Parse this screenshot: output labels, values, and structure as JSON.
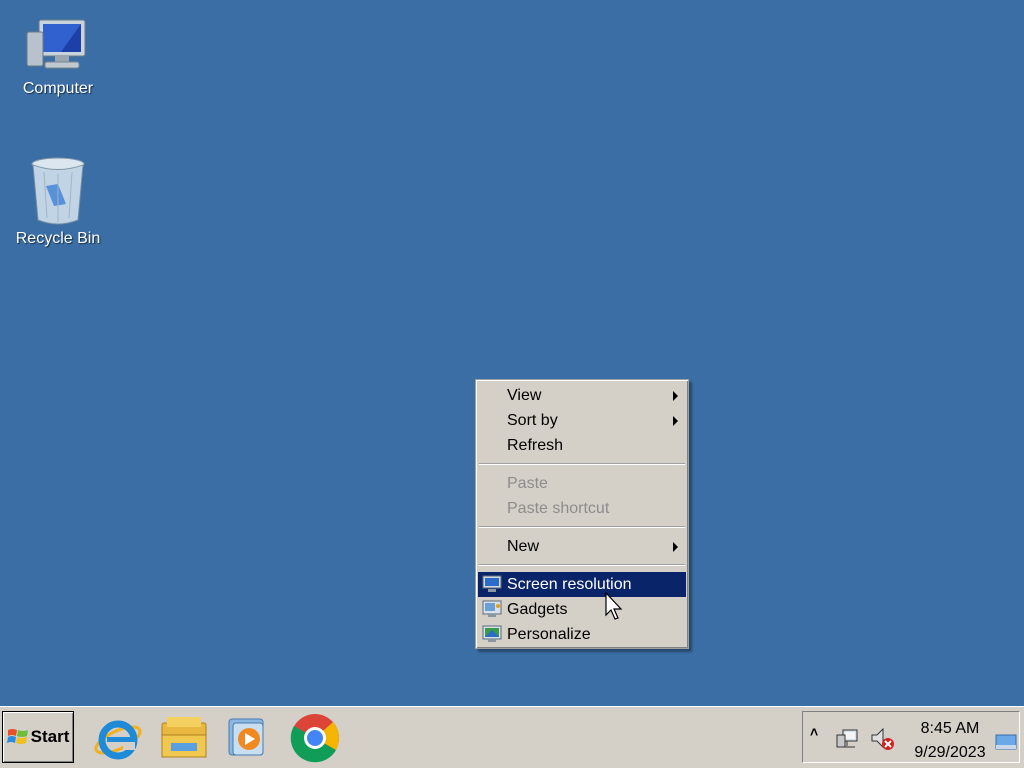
{
  "desktop": {
    "icons": [
      {
        "label": "Computer",
        "icon": "computer-icon"
      },
      {
        "label": "Recycle Bin",
        "icon": "recycle-bin-icon"
      }
    ],
    "background_color": "#3a6ea5"
  },
  "context_menu": {
    "items": [
      {
        "label": "View",
        "has_submenu": true
      },
      {
        "label": "Sort by",
        "has_submenu": true
      },
      {
        "label": "Refresh"
      },
      {
        "label": "Paste",
        "disabled": true
      },
      {
        "label": "Paste shortcut",
        "disabled": true
      },
      {
        "label": "New",
        "has_submenu": true
      },
      {
        "label": "Screen resolution",
        "icon": "display-icon",
        "highlighted": true
      },
      {
        "label": "Gadgets",
        "icon": "gadgets-icon"
      },
      {
        "label": "Personalize",
        "icon": "personalize-icon"
      }
    ],
    "highlight_color": "#0a246a"
  },
  "taskbar": {
    "start_label": "Start",
    "pinned": [
      {
        "name": "internet-explorer-icon"
      },
      {
        "name": "file-explorer-icon"
      },
      {
        "name": "media-player-icon"
      },
      {
        "name": "chrome-icon"
      }
    ],
    "tray": {
      "time": "8:45 AM",
      "date": "9/29/2023"
    }
  }
}
